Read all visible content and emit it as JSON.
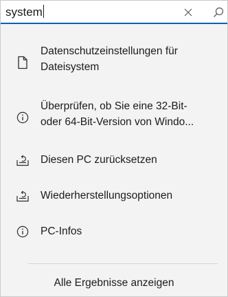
{
  "search": {
    "value": "system",
    "clear_icon": "close-icon",
    "search_icon": "search-icon"
  },
  "results": [
    {
      "icon": "document-icon",
      "lines": [
        "Datenschutzeinstellungen für",
        "Dateisystem"
      ]
    },
    {
      "icon": "info-icon",
      "lines": [
        "Überprüfen, ob Sie eine 32-Bit-",
        "oder 64-Bit-Version von Windo..."
      ]
    },
    {
      "icon": "recovery-icon",
      "lines": [
        "Diesen PC zurücksetzen"
      ]
    },
    {
      "icon": "recovery-icon",
      "lines": [
        "Wiederherstellungsoptionen"
      ]
    },
    {
      "icon": "info-icon",
      "lines": [
        "PC-Infos"
      ]
    }
  ],
  "footer": {
    "show_all_label": "Alle Ergebnisse anzeigen"
  },
  "colors": {
    "accent": "#0a5fb4",
    "panel_background": "#f3f3f3",
    "text": "#1b1b1b"
  }
}
